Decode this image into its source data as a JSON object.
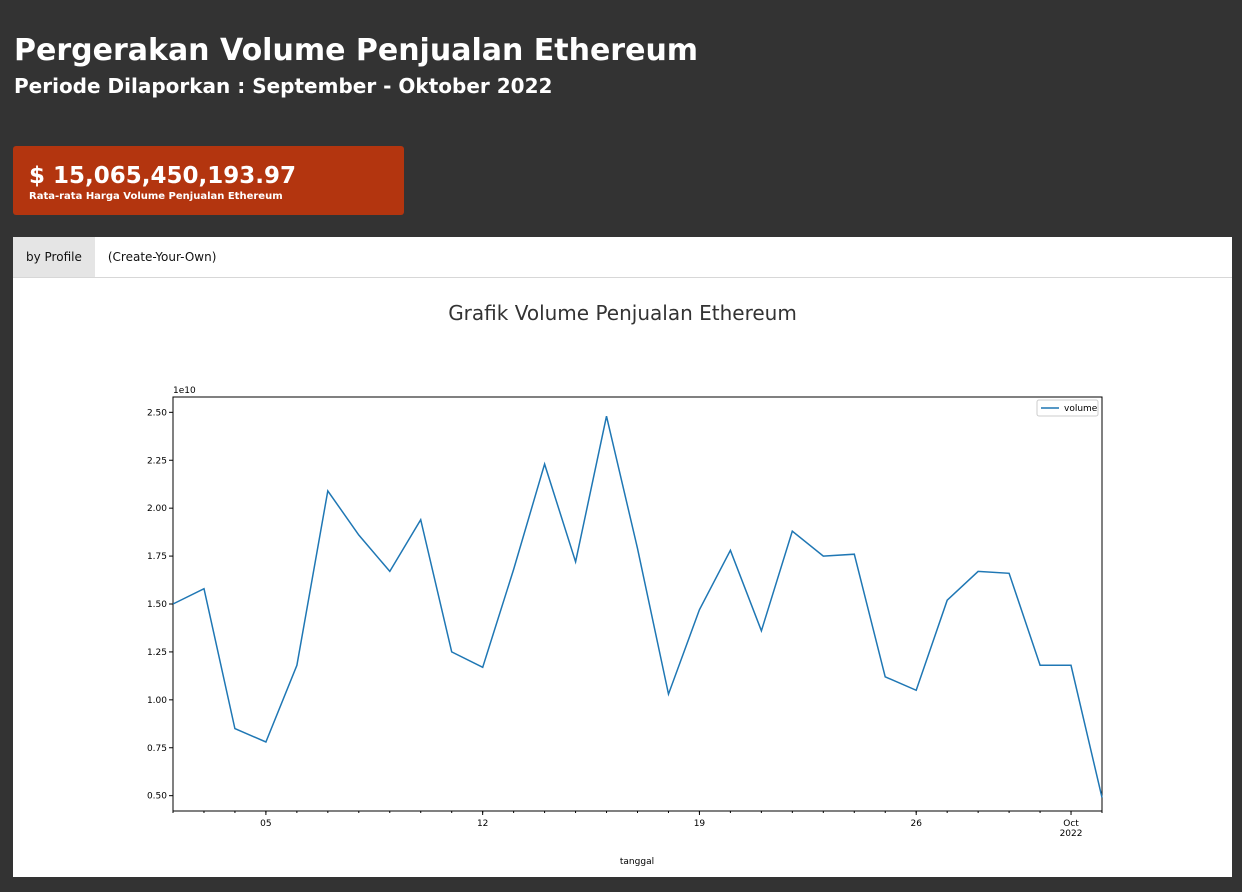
{
  "header": {
    "title": "Pergerakan Volume Penjualan Ethereum",
    "subtitle": "Periode Dilaporkan : September - Oktober 2022"
  },
  "stat": {
    "value": "$ 15,065,450,193.97",
    "caption": "Rata-rata Harga Volume Penjualan Ethereum"
  },
  "tabs": [
    {
      "label": "by Profile",
      "active": true
    },
    {
      "label": "(Create-Your-Own)",
      "active": false
    }
  ],
  "colors": {
    "background": "#333333",
    "card": "#b3350f",
    "line": "#1f77b4"
  },
  "chart_data": {
    "type": "line",
    "title": "Grafik Volume Penjualan Ethereum",
    "xlabel": "tanggal",
    "ylabel": "",
    "y_offset_label": "1e10",
    "ylim": [
      0.42,
      2.58
    ],
    "yticks": [
      "0.50",
      "0.75",
      "1.00",
      "1.25",
      "1.50",
      "1.75",
      "2.00",
      "2.25",
      "2.50"
    ],
    "xticks": [
      {
        "date": "2022-09-05",
        "label": "05"
      },
      {
        "date": "2022-09-12",
        "label": "12"
      },
      {
        "date": "2022-09-19",
        "label": "19"
      },
      {
        "date": "2022-09-26",
        "label": "26"
      },
      {
        "date": "2022-10-01",
        "label": "Oct\n2022"
      }
    ],
    "legend": "top-right",
    "series": [
      {
        "name": "volume",
        "x": [
          "2022-09-02",
          "2022-09-03",
          "2022-09-04",
          "2022-09-05",
          "2022-09-06",
          "2022-09-07",
          "2022-09-08",
          "2022-09-09",
          "2022-09-10",
          "2022-09-11",
          "2022-09-12",
          "2022-09-13",
          "2022-09-14",
          "2022-09-15",
          "2022-09-16",
          "2022-09-17",
          "2022-09-18",
          "2022-09-19",
          "2022-09-20",
          "2022-09-21",
          "2022-09-22",
          "2022-09-23",
          "2022-09-24",
          "2022-09-25",
          "2022-09-26",
          "2022-09-27",
          "2022-09-28",
          "2022-09-29",
          "2022-09-30",
          "2022-10-01",
          "2022-10-02"
        ],
        "values": [
          1.5,
          1.58,
          0.85,
          0.78,
          1.18,
          2.09,
          1.86,
          1.67,
          1.94,
          1.25,
          1.17,
          1.68,
          2.23,
          1.72,
          2.48,
          1.79,
          1.03,
          1.47,
          1.78,
          1.36,
          1.88,
          1.75,
          1.76,
          1.12,
          1.05,
          1.52,
          1.67,
          1.66,
          1.18,
          1.18,
          0.49
        ]
      }
    ]
  }
}
